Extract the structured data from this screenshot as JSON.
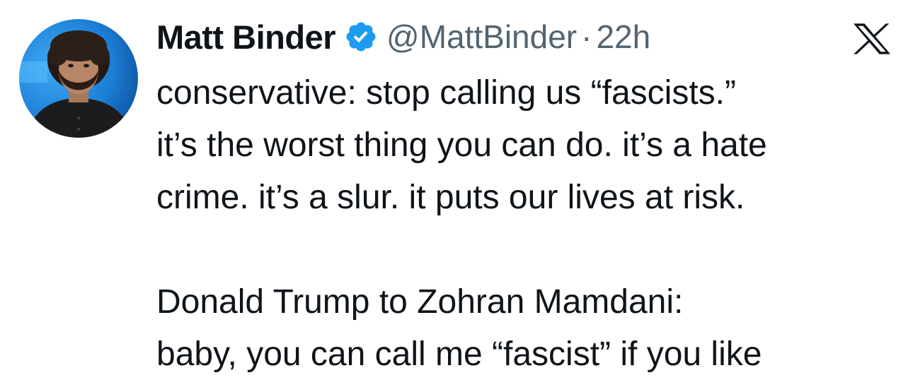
{
  "author": {
    "display_name": "Matt Binder",
    "handle": "@MattBinder",
    "separator": "·",
    "time": "22h",
    "verified_icon": "verified-badge-icon",
    "avatar_icon": "avatar"
  },
  "brand": {
    "logo_icon": "x-logo-icon",
    "verified_color": "#1d9bf0",
    "text_color": "#0f1419",
    "secondary_text_color": "#536471"
  },
  "tweet": {
    "paragraphs": [
      {
        "lines": [
          "conservative: stop calling us “fascists.”",
          "it’s the worst thing you can do. it’s a hate",
          "crime. it’s a slur. it puts our lives at risk."
        ]
      },
      {
        "lines": [
          "Donald Trump to Zohran Mamdani:",
          "baby, you can call me “fascist” if you like"
        ]
      }
    ]
  }
}
